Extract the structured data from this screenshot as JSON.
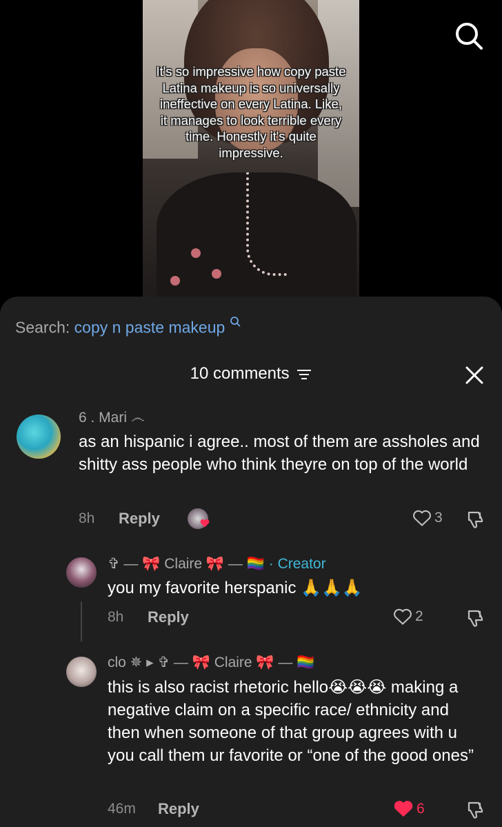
{
  "video": {
    "overlay_text": "It's so impressive how copy paste Latina makeup is so universally ineffective on every Latina. Like, it manages to look terrible every time. Honestly it's quite impressive."
  },
  "search": {
    "label": "Search:",
    "query": "copy n paste makeup"
  },
  "comments_header": {
    "title": "10 comments"
  },
  "comments": [
    {
      "username": "6  .    Mari  ෴",
      "text": "as an hispanic i agree.. most of them are assholes and shitty ass people who think theyre on top of the world",
      "time": "8h",
      "reply_label": "Reply",
      "likes": "3"
    },
    {
      "username": "✞ — 🎀 Claire 🎀 — 🏳️‍🌈",
      "creator_tag": " · Creator",
      "text": "you my favorite herspanic 🙏🙏🙏",
      "time": "8h",
      "reply_label": "Reply",
      "likes": "2"
    },
    {
      "username": "clo ✵ ▸ ✞ — 🎀 Claire 🎀 — 🏳️‍🌈",
      "text": "this is also racist rhetoric hello😭😭😭 making a negative claim on a specific race/ ethnicity and then when someone of that group agrees with u you call them ur favorite or “one of the good ones”",
      "time": "46m",
      "reply_label": "Reply",
      "likes": "6"
    }
  ],
  "colors": {
    "sheet_bg": "#1f1f1f",
    "query_blue": "#6fa8e6",
    "creator_cyan": "#3fb8d8",
    "liked_red": "#fe2c55"
  }
}
